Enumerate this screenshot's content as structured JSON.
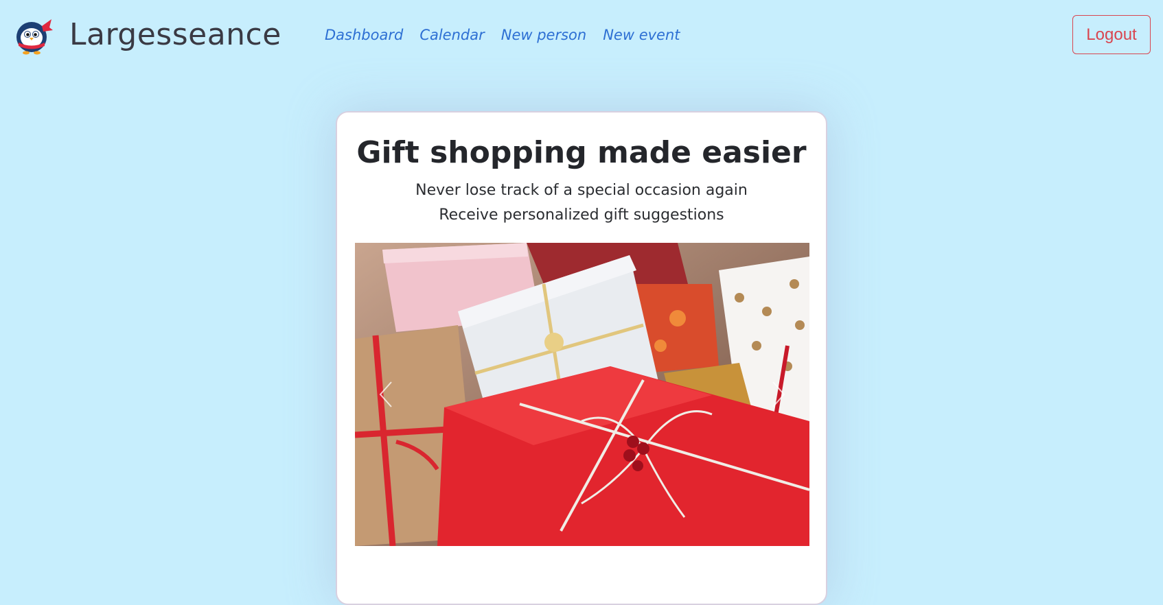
{
  "navbar": {
    "brand_name": "Largesseance",
    "logo_icon": "penguin-logo-icon",
    "links": [
      {
        "label": "Dashboard"
      },
      {
        "label": "Calendar"
      },
      {
        "label": "New person"
      },
      {
        "label": "New event"
      }
    ],
    "logout_label": "Logout"
  },
  "hero": {
    "title": "Gift shopping made easier",
    "subtitle_1": "Never lose track of a special occasion again",
    "subtitle_2": "Receive personalized gift suggestions",
    "carousel": {
      "prev_icon": "chevron-left-icon",
      "next_icon": "chevron-right-icon"
    }
  },
  "colors": {
    "background": "#c7eefd",
    "nav_link": "#2d6fd3",
    "logout": "#d9454f",
    "card": "#ffffff",
    "text": "#24262b"
  }
}
